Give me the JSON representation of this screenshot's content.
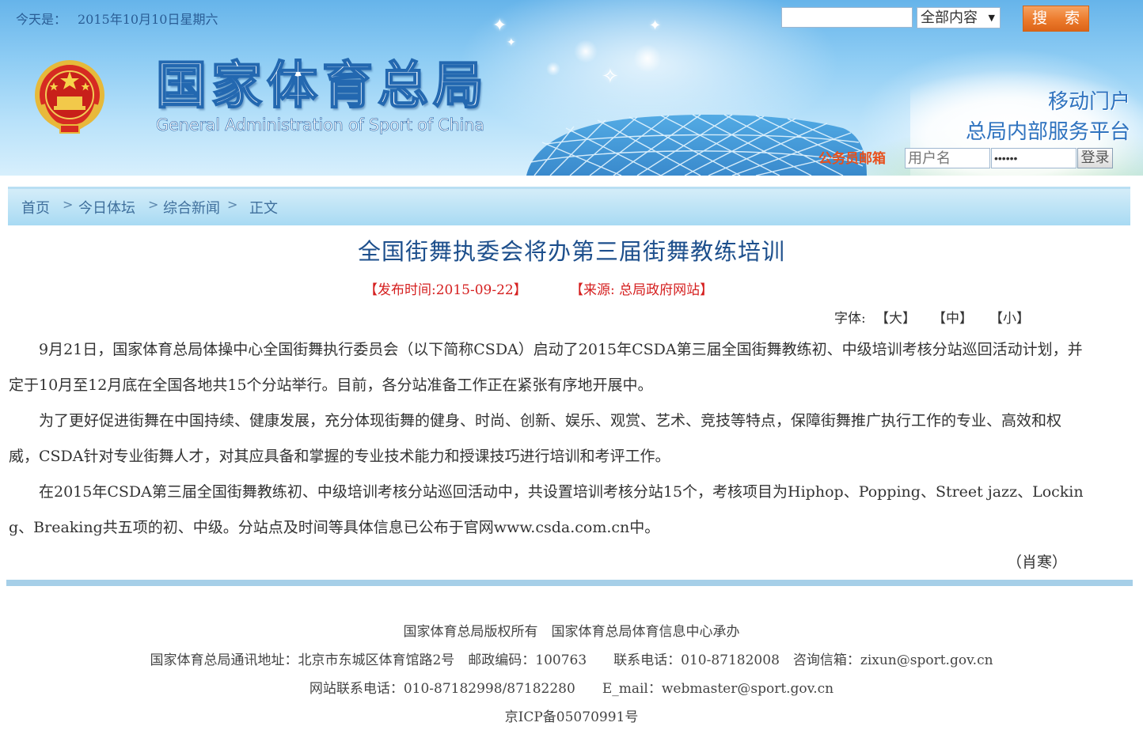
{
  "header": {
    "date_label": "今天是：",
    "date_value": "2015年10月10日星期六",
    "search": {
      "placeholder": "",
      "scope_selected": "全部内容",
      "button_label": "搜 索"
    },
    "logo": {
      "title_cn": "国家体育总局",
      "title_en": "General Administration of Sport of China"
    },
    "links": {
      "mobile_portal": "移动门户",
      "internal_platform": "总局内部服务平台"
    },
    "login": {
      "mailbox_label": "公务员邮箱",
      "username_placeholder": "用户名",
      "password_value": "••••••",
      "button_label": "登录"
    }
  },
  "breadcrumb": {
    "items": [
      "首页",
      "今日体坛",
      "综合新闻",
      "正文"
    ],
    "separator": ">"
  },
  "article": {
    "title": "全国街舞执委会将办第三届街舞教练培训",
    "publish_time": "【发布时间:2015-09-22】",
    "source": "【来源: 总局政府网站】",
    "font_size": {
      "label": "字体:",
      "large": "【大】",
      "medium": "【中】",
      "small": "【小】"
    },
    "paragraphs": [
      "9月21日，国家体育总局体操中心全国街舞执行委员会（以下简称CSDA）启动了2015年CSDA第三届全国街舞教练初、中级培训考核分站巡回活动计划，并定于10月至12月底在全国各地共15个分站举行。目前，各分站准备工作正在紧张有序地开展中。",
      "为了更好促进街舞在中国持续、健康发展，充分体现街舞的健身、时尚、创新、娱乐、观赏、艺术、竞技等特点，保障街舞推广执行工作的专业、高效和权威，CSDA针对专业街舞人才，对其应具备和掌握的专业技术能力和授课技巧进行培训和考评工作。",
      "在2015年CSDA第三届全国街舞教练初、中级培训考核分站巡回活动中，共设置培训考核分站15个，考核项目为Hiphop、Popping、Street  jazz、Locking、Breaking共五项的初、中级。分站点及时间等具体信息已公布于官网www.csda.com.cn中。"
    ],
    "author": "（肖寒）"
  },
  "footer": {
    "line1": "国家体育总局版权所有　国家体育总局体育信息中心承办",
    "line2": "国家体育总局通讯地址：北京市东城区体育馆路2号　邮政编码：100763　　联系电话：010-87182008　咨询信箱：zixun@sport.gov.cn",
    "line3": "网站联系电话：010-87182998/87182280　　E_mail：webmaster@sport.gov.cn",
    "line4": "京ICP备05070991号"
  },
  "colors": {
    "banner_top": "#66b4ea",
    "title_blue": "#1d4f8c",
    "meta_red": "#d51f1f",
    "search_orange": "#ec7a2c",
    "breadcrumb_bg": "#a8daf3",
    "divider": "#a6cfe8"
  },
  "icons": [
    "national-emblem-icon",
    "dropdown-arrow-icon",
    "stadium-illustration"
  ]
}
